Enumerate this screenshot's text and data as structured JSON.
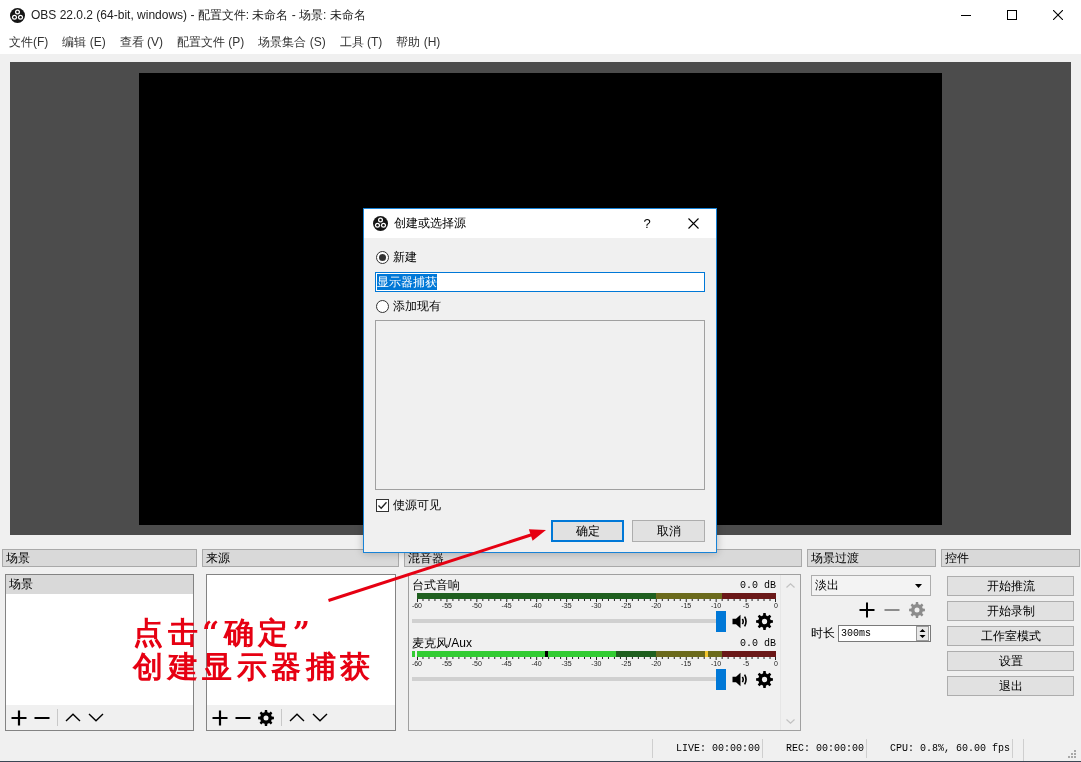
{
  "window": {
    "title": "OBS 22.0.2 (64-bit, windows) - 配置文件: 未命名 - 场景: 未命名"
  },
  "menu": [
    "文件(F)",
    "编辑 (E)",
    "查看 (V)",
    "配置文件 (P)",
    "场景集合 (S)",
    "工具 (T)",
    "帮助 (H)"
  ],
  "scenes_dock": {
    "title": "场景",
    "items": [
      {
        "label": "场景",
        "selected": true
      }
    ],
    "toolbar": [
      {
        "kind": "add",
        "disabled": false
      },
      {
        "kind": "remove",
        "disabled": false
      },
      {
        "kind": "separator"
      },
      {
        "kind": "move_up",
        "disabled": false
      },
      {
        "kind": "move_down",
        "disabled": false
      }
    ]
  },
  "sources_dock": {
    "title": "来源",
    "toolbar": [
      {
        "kind": "add",
        "disabled": false
      },
      {
        "kind": "remove",
        "disabled": false
      },
      {
        "kind": "properties",
        "disabled": false
      },
      {
        "kind": "separator"
      },
      {
        "kind": "move_up",
        "disabled": false
      },
      {
        "kind": "move_down",
        "disabled": false
      }
    ]
  },
  "mixer_dock": {
    "title": "混音器",
    "channels": [
      {
        "name": "台式音响",
        "reading": "0.0 dB",
        "meter": {
          "level": 0
        },
        "scale": [
          "-60",
          "-55",
          "-50",
          "-45",
          "-40",
          "-35",
          "-30",
          "-25",
          "-20",
          "-15",
          "-10",
          "-5",
          "0"
        ],
        "volume": {
          "level": 1
        },
        "muted": false
      },
      {
        "name": "麦克风/Aux",
        "reading": "0.0 dB",
        "meter": {
          "level": 0.555,
          "magnitude": {
            "level": 0.36
          },
          "peak_hold": {
            "level": 0.805
          }
        },
        "scale": [
          "-60",
          "-55",
          "-50",
          "-45",
          "-40",
          "-35",
          "-30",
          "-25",
          "-20",
          "-15",
          "-10",
          "-5",
          "0"
        ],
        "volume": {
          "level": 1
        },
        "muted": false
      }
    ]
  },
  "transitions_dock": {
    "title": "场景过渡",
    "transition": "淡出",
    "toolbar": [
      {
        "kind": "add",
        "disabled": false
      },
      {
        "kind": "remove",
        "disabled": true
      },
      {
        "kind": "properties",
        "disabled": true
      }
    ],
    "duration": {
      "label": "时长",
      "value": "300ms"
    }
  },
  "controls_dock": {
    "title": "控件",
    "buttons": [
      "开始推流",
      "开始录制",
      "工作室模式",
      "设置",
      "退出"
    ]
  },
  "status_bar": {
    "live": "LIVE: 00:00:00",
    "rec": "REC: 00:00:00",
    "cpu": "CPU: 0.8%, 60.00 fps"
  },
  "dialog": {
    "title": "创建或选择源",
    "help": "?",
    "new_option": {
      "label": "新建",
      "selected": true
    },
    "name_field": {
      "value": "显示器捕获",
      "value_selected": true,
      "focused": true
    },
    "existing_option": {
      "label": "添加现有",
      "selected": false
    },
    "visible_checkbox": {
      "label": "使源可见",
      "checked": true
    },
    "buttons": [
      {
        "label": "确定",
        "default": true
      },
      {
        "label": "取消",
        "default": false
      }
    ]
  },
  "annotation": {
    "lines": [
      "点击“确定”",
      "创建显示器捕获"
    ]
  }
}
